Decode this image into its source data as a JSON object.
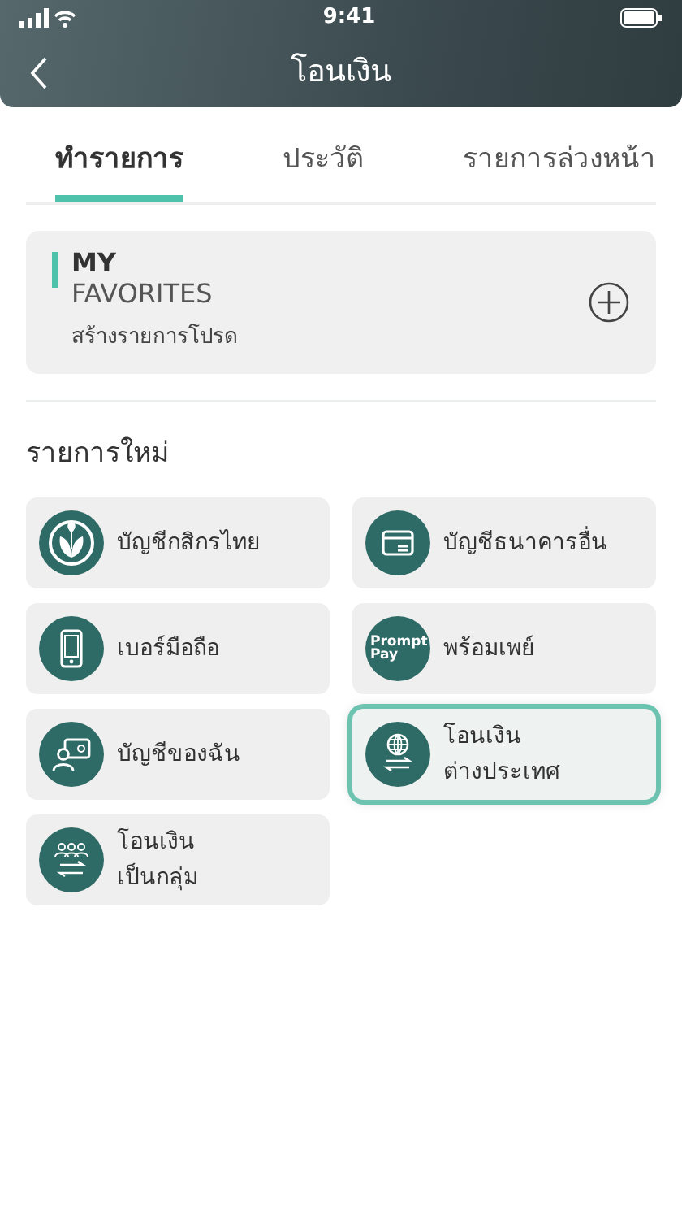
{
  "status_bar": {
    "time": "9:41"
  },
  "header": {
    "title": "โอนเงิน"
  },
  "tabs": [
    {
      "label": "ทำรายการ",
      "selected": true
    },
    {
      "label": "ประวัติ",
      "selected": false
    },
    {
      "label": "รายการล่วงหน้า",
      "selected": false
    }
  ],
  "favorites": {
    "title_bold": "MY",
    "title": "FAVORITES",
    "subtitle": "สร้างรายการโปรด"
  },
  "section_title": "รายการใหม่",
  "tiles": [
    {
      "kind": "leaf",
      "lines": [
        "บัญชีกสิกรไทย"
      ],
      "selected": false
    },
    {
      "kind": "card",
      "lines": [
        "บัญชีธนาคารอื่น"
      ],
      "selected": false
    },
    {
      "kind": "phone",
      "lines": [
        "เบอร์มือถือ"
      ],
      "selected": false
    },
    {
      "kind": "promptpay",
      "icon_text": [
        "Prompt",
        "Pay"
      ],
      "lines": [
        "พร้อมเพย์"
      ],
      "selected": false
    },
    {
      "kind": "account",
      "lines": [
        "บัญชีของฉัน"
      ],
      "selected": false
    },
    {
      "kind": "globe",
      "lines": [
        "โอนเงิน",
        "ต่างประเทศ"
      ],
      "selected": true
    },
    {
      "kind": "group",
      "lines": [
        "โอนเงิน",
        "เป็นกลุ่ม"
      ],
      "selected": false
    }
  ]
}
